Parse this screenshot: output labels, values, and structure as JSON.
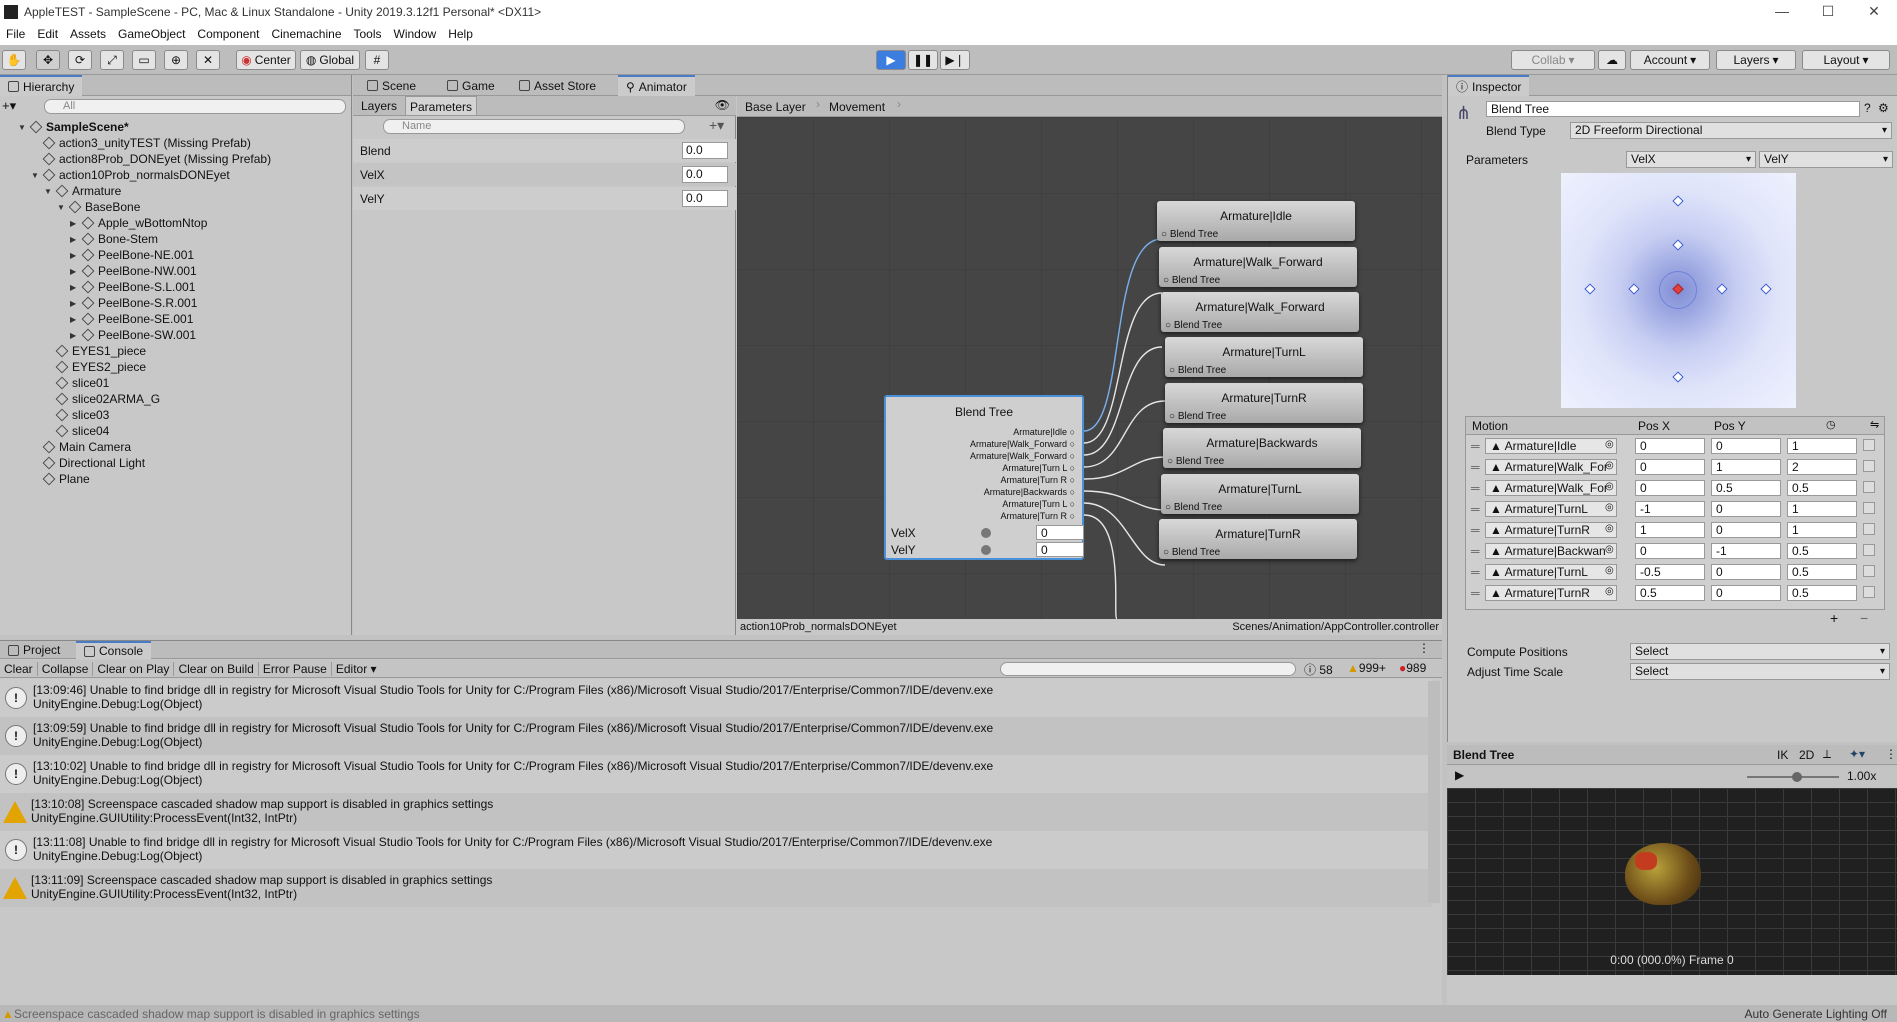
{
  "window": {
    "title": "AppleTEST - SampleScene - PC, Mac & Linux Standalone - Unity 2019.3.12f1 Personal* <DX11>"
  },
  "menu": [
    "File",
    "Edit",
    "Assets",
    "GameObject",
    "Component",
    "Cinemachine",
    "Tools",
    "Window",
    "Help"
  ],
  "toolbar": {
    "center": "Center",
    "global": "Global",
    "collab": "Collab",
    "account": "Account",
    "layers": "Layers",
    "layout": "Layout"
  },
  "hierarchy": {
    "tab": "Hierarchy",
    "search_placeholder": "All",
    "items": [
      {
        "label": "SampleScene*",
        "depth": 0,
        "arrow": "▼",
        "bold": true
      },
      {
        "label": "action3_unityTEST (Missing Prefab)",
        "depth": 1,
        "arrow": ""
      },
      {
        "label": "action8Prob_DONEyet (Missing Prefab)",
        "depth": 1,
        "arrow": ""
      },
      {
        "label": "action10Prob_normalsDONEyet",
        "depth": 1,
        "arrow": "▼"
      },
      {
        "label": "Armature",
        "depth": 2,
        "arrow": "▼"
      },
      {
        "label": "BaseBone",
        "depth": 3,
        "arrow": "▼"
      },
      {
        "label": "Apple_wBottomNtop",
        "depth": 4,
        "arrow": "▶"
      },
      {
        "label": "Bone-Stem",
        "depth": 4,
        "arrow": "▶"
      },
      {
        "label": "PeelBone-NE.001",
        "depth": 4,
        "arrow": "▶"
      },
      {
        "label": "PeelBone-NW.001",
        "depth": 4,
        "arrow": "▶"
      },
      {
        "label": "PeelBone-S.L.001",
        "depth": 4,
        "arrow": "▶"
      },
      {
        "label": "PeelBone-S.R.001",
        "depth": 4,
        "arrow": "▶"
      },
      {
        "label": "PeelBone-SE.001",
        "depth": 4,
        "arrow": "▶"
      },
      {
        "label": "PeelBone-SW.001",
        "depth": 4,
        "arrow": "▶"
      },
      {
        "label": "EYES1_piece",
        "depth": 2,
        "arrow": ""
      },
      {
        "label": "EYES2_piece",
        "depth": 2,
        "arrow": ""
      },
      {
        "label": "slice01",
        "depth": 2,
        "arrow": ""
      },
      {
        "label": "slice02ARMA_G",
        "depth": 2,
        "arrow": ""
      },
      {
        "label": "slice03",
        "depth": 2,
        "arrow": ""
      },
      {
        "label": "slice04",
        "depth": 2,
        "arrow": ""
      },
      {
        "label": "Main Camera",
        "depth": 1,
        "arrow": ""
      },
      {
        "label": "Directional Light",
        "depth": 1,
        "arrow": ""
      },
      {
        "label": "Plane",
        "depth": 1,
        "arrow": ""
      }
    ]
  },
  "center_tabs": [
    "Scene",
    "Game",
    "Asset Store",
    "Animator"
  ],
  "animator": {
    "subtabs": [
      "Layers",
      "Parameters"
    ],
    "name_placeholder": "Name",
    "params": [
      {
        "name": "Blend",
        "value": "0.0"
      },
      {
        "name": "VelX",
        "value": "0.0"
      },
      {
        "name": "VelY",
        "value": "0.0"
      }
    ],
    "breadcrumb": [
      "Base Layer",
      "Movement"
    ],
    "blend_tree": {
      "title": "Blend Tree",
      "outputs": [
        "Armature|Idle",
        "Armature|Walk_Forward",
        "Armature|Walk_Forward",
        "Armature|Turn L",
        "Armature|Turn R",
        "Armature|Backwards",
        "Armature|Turn L",
        "Armature|Turn R"
      ],
      "velx_label": "VelX",
      "velx": "0",
      "vely_label": "VelY",
      "vely": "0"
    },
    "clip_nodes": [
      {
        "title": "Armature|Idle",
        "sub": "Blend Tree"
      },
      {
        "title": "Armature|Walk_Forward",
        "sub": "Blend Tree"
      },
      {
        "title": "Armature|Walk_Forward",
        "sub": "Blend Tree"
      },
      {
        "title": "Armature|TurnL",
        "sub": "Blend Tree"
      },
      {
        "title": "Armature|TurnR",
        "sub": "Blend Tree"
      },
      {
        "title": "Armature|Backwards",
        "sub": "Blend Tree"
      },
      {
        "title": "Armature|TurnL",
        "sub": "Blend Tree"
      },
      {
        "title": "Armature|TurnR",
        "sub": "Blend Tree"
      }
    ],
    "footer_left": "action10Prob_normalsDONEyet",
    "footer_right": "Scenes/Animation/AppController.controller"
  },
  "inspector": {
    "tab": "Inspector",
    "name": "Blend Tree",
    "blend_type_label": "Blend Type",
    "blend_type": "2D Freeform Directional",
    "parameters_label": "Parameters",
    "param_x": "VelX",
    "param_y": "VelY",
    "motion_headers": [
      "Motion",
      "Pos X",
      "Pos Y"
    ],
    "motions": [
      {
        "name": "Armature|Idle",
        "x": "0",
        "y": "0",
        "s": "1"
      },
      {
        "name": "Armature|Walk_For",
        "x": "0",
        "y": "1",
        "s": "2"
      },
      {
        "name": "Armature|Walk_For",
        "x": "0",
        "y": "0.5",
        "s": "0.5"
      },
      {
        "name": "Armature|TurnL",
        "x": "-1",
        "y": "0",
        "s": "1"
      },
      {
        "name": "Armature|TurnR",
        "x": "1",
        "y": "0",
        "s": "1"
      },
      {
        "name": "Armature|Backwan",
        "x": "0",
        "y": "-1",
        "s": "0.5"
      },
      {
        "name": "Armature|TurnL",
        "x": "-0.5",
        "y": "0",
        "s": "0.5"
      },
      {
        "name": "Armature|TurnR",
        "x": "0.5",
        "y": "0",
        "s": "0.5"
      }
    ],
    "compute_label": "Compute Positions",
    "compute_value": "Select",
    "adjust_label": "Adjust Time Scale",
    "adjust_value": "Select"
  },
  "preview": {
    "title": "Blend Tree",
    "ik": "IK",
    "twod": "2D",
    "speed": "1.00x",
    "frame": "0:00 (000.0%) Frame 0"
  },
  "console": {
    "tabs": [
      "Project",
      "Console"
    ],
    "buttons": [
      "Clear",
      "Collapse",
      "Clear on Play",
      "Clear on Build",
      "Error Pause",
      "Editor"
    ],
    "counts": {
      "info": "58",
      "warn": "999+",
      "error": "989"
    },
    "entries": [
      {
        "type": "info",
        "line1": "[13:09:46] Unable to find bridge dll in registry for Microsoft Visual Studio Tools for Unity for C:/Program Files (x86)/Microsoft Visual Studio/2017/Enterprise/Common7/IDE/devenv.exe",
        "line2": "UnityEngine.Debug:Log(Object)"
      },
      {
        "type": "info",
        "line1": "[13:09:59] Unable to find bridge dll in registry for Microsoft Visual Studio Tools for Unity for C:/Program Files (x86)/Microsoft Visual Studio/2017/Enterprise/Common7/IDE/devenv.exe",
        "line2": "UnityEngine.Debug:Log(Object)"
      },
      {
        "type": "info",
        "line1": "[13:10:02] Unable to find bridge dll in registry for Microsoft Visual Studio Tools for Unity for C:/Program Files (x86)/Microsoft Visual Studio/2017/Enterprise/Common7/IDE/devenv.exe",
        "line2": "UnityEngine.Debug:Log(Object)"
      },
      {
        "type": "warn",
        "line1": "[13:10:08] Screenspace cascaded shadow map support is disabled in graphics settings",
        "line2": "UnityEngine.GUIUtility:ProcessEvent(Int32, IntPtr)"
      },
      {
        "type": "info",
        "line1": "[13:11:08] Unable to find bridge dll in registry for Microsoft Visual Studio Tools for Unity for C:/Program Files (x86)/Microsoft Visual Studio/2017/Enterprise/Common7/IDE/devenv.exe",
        "line2": "UnityEngine.Debug:Log(Object)"
      },
      {
        "type": "warn",
        "line1": "[13:11:09] Screenspace cascaded shadow map support is disabled in graphics settings",
        "line2": "UnityEngine.GUIUtility:ProcessEvent(Int32, IntPtr)"
      }
    ]
  },
  "status": {
    "message": "Screenspace cascaded shadow map support is disabled in graphics settings",
    "right": "Auto Generate Lighting Off"
  }
}
